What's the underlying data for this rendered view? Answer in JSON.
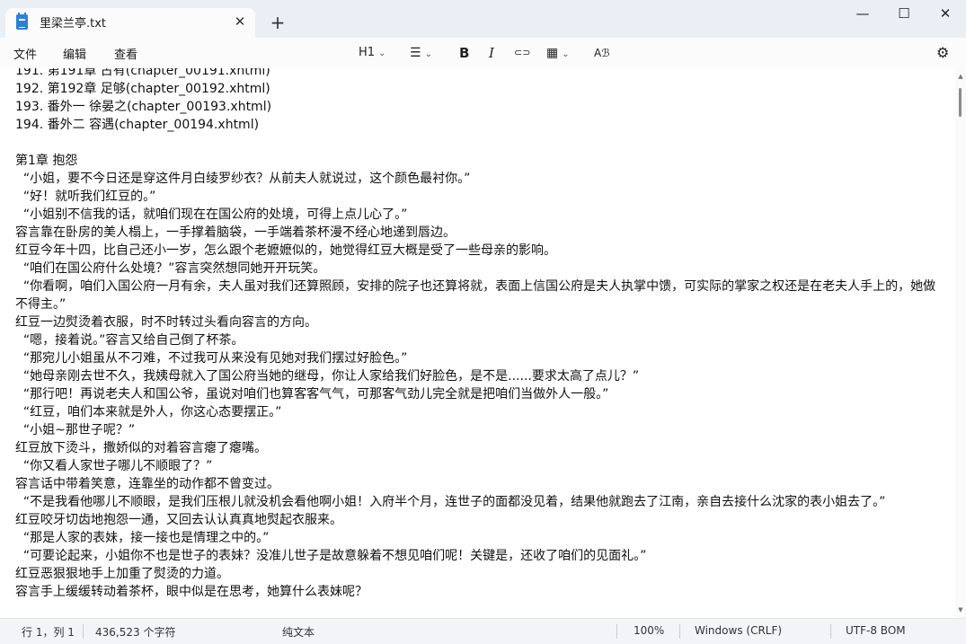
{
  "window": {
    "tab_title": "里梁兰亭.txt",
    "close_tab": "✕",
    "new_tab": "+",
    "minimize": "—",
    "maximize": "☐",
    "close": "✕"
  },
  "menu": {
    "file": "文件",
    "edit": "编辑",
    "view": "查看"
  },
  "toolbar": {
    "heading": "H1",
    "list_icon": "☰",
    "bold": "B",
    "italic": "I",
    "link_icon": "⊂⊃",
    "table_icon": "▦",
    "spell_icon": "Aℬ",
    "settings_icon": "⚙",
    "chevron": "⌄"
  },
  "document": {
    "lines": [
      "191. 第191章 古有(chapter_00191.xhtml)",
      "192. 第192章 足够(chapter_00192.xhtml)",
      "193. 番外一 徐晏之(chapter_00193.xhtml)",
      "194. 番外二 容遇(chapter_00194.xhtml)",
      "",
      "第1章 抱怨",
      "  “小姐，要不今日还是穿这件月白绫罗纱衣？从前夫人就说过，这个颜色最衬你。”",
      "  “好！就听我们红豆的。”",
      "  “小姐别不信我的话，就咱们现在在国公府的处境，可得上点儿心了。”",
      "容言靠在卧房的美人榻上，一手撑着脑袋，一手端着茶杯漫不经心地递到唇边。",
      "红豆今年十四，比自己还小一岁，怎么跟个老嬷嬷似的，她觉得红豆大概是受了一些母亲的影响。",
      "  “咱们在国公府什么处境？”容言突然想同她开开玩笑。",
      "  “你看啊，咱们入国公府一月有余，夫人虽对我们还算照顾，安排的院子也还算将就，表面上信国公府是夫人执掌中馈，可实际的掌家之权还是在老夫人手上的，她做不得主。”",
      "红豆一边熨烫着衣服，时不时转过头看向容言的方向。",
      "  “嗯，接着说。”容言又给自己倒了杯茶。",
      "  “那宛儿小姐虽从不刁难，不过我可从来没有见她对我们摆过好脸色。”",
      "  “她母亲刚去世不久，我姨母就入了国公府当她的继母，你让人家给我们好脸色，是不是......要求太高了点儿？”",
      "  “那行吧！再说老夫人和国公爷，虽说对咱们也算客客气气，可那客气劲儿完全就是把咱们当做外人一般。”",
      "  “红豆，咱们本来就是外人，你这心态要摆正。”",
      "  “小姐~那世子呢？”",
      "红豆放下烫斗，撒娇似的对着容言瘪了瘪嘴。",
      "  “你又看人家世子哪儿不顺眼了？”",
      "容言话中带着笑意，连靠坐的动作都不曾变过。",
      "  “不是我看他哪儿不顺眼，是我们压根儿就没机会看他啊小姐！入府半个月，连世子的面都没见着，结果他就跑去了江南，亲自去接什么沈家的表小姐去了。”",
      "红豆咬牙切齿地抱怨一通，又回去认认真真地熨起衣服来。",
      "  “那是人家的表妹，接一接也是情理之中的。”",
      "  “可要论起来，小姐你不也是世子的表妹？没准儿世子是故意躲着不想见咱们呢！关键是，还收了咱们的见面礼。”",
      "红豆恶狠狠地手上加重了熨烫的力道。",
      "容言手上缓缓转动着茶杯，眼中似是在思考，她算什么表妹呢？"
    ]
  },
  "status": {
    "position": "行 1，列 1",
    "char_count": "436,523 个字符",
    "format": "纯文本",
    "zoom": "100%",
    "line_ending": "Windows (CRLF)",
    "encoding": "UTF-8 BOM"
  }
}
